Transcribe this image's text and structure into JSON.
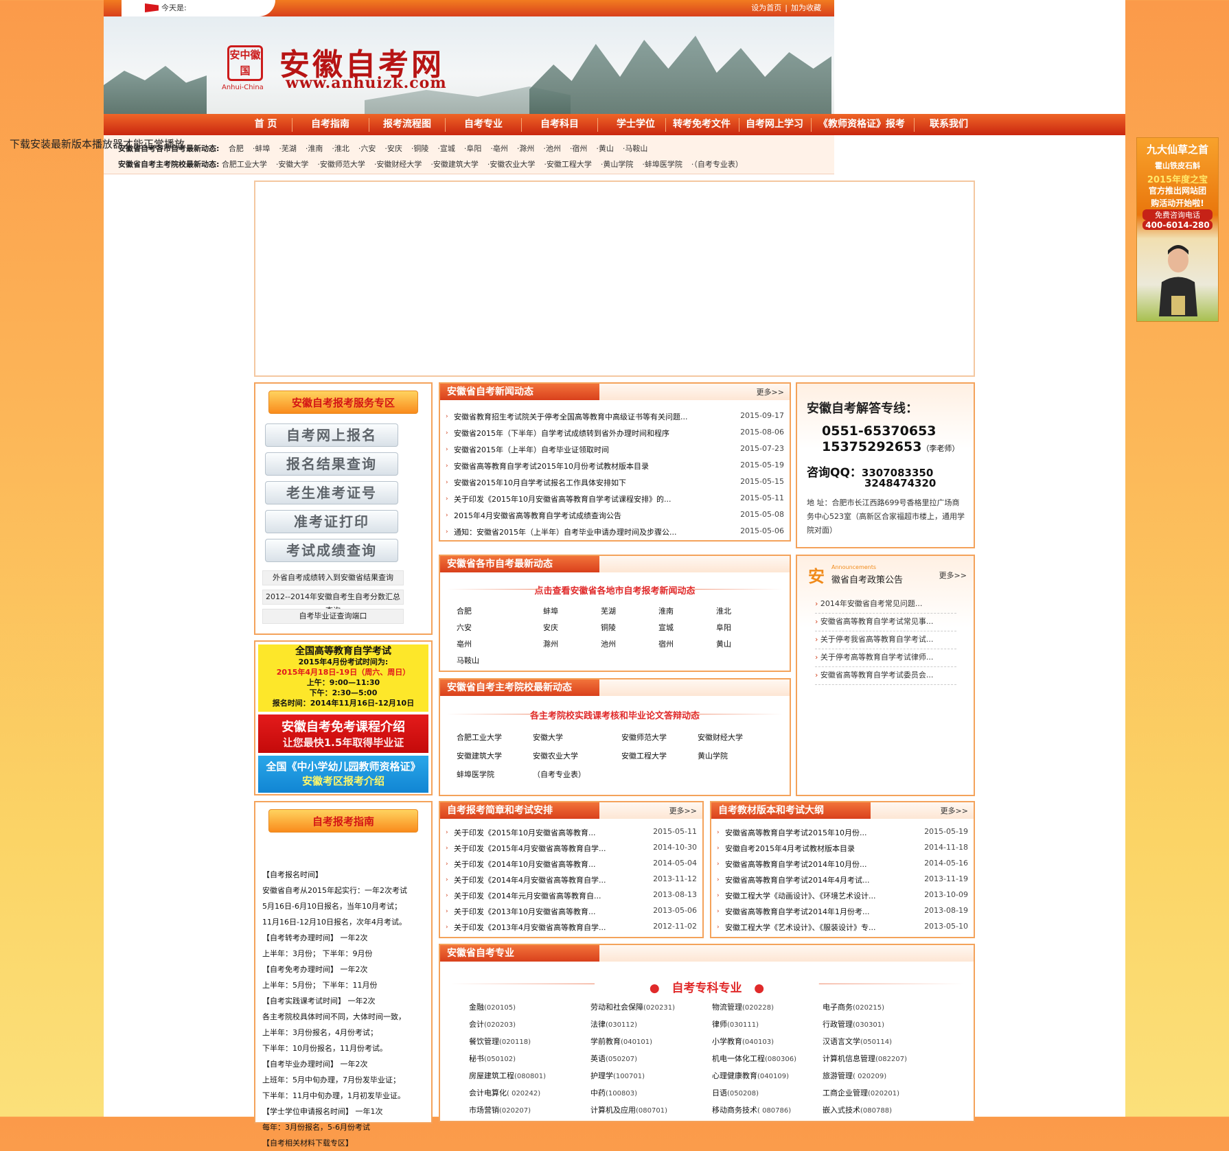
{
  "header": {
    "today_label": "今天是:",
    "set_home": "设为首页",
    "add_fav": "加为收藏",
    "site_title": "安徽自考网",
    "site_url": "www.anhuizk.com",
    "seal_text": "安中徽国",
    "seal_sub": "Anhui-China"
  },
  "nav": [
    "首 页",
    "自考指南",
    "报考流程图",
    "自考专业",
    "自考科目",
    "学士学位",
    "转考免考文件",
    "自考网上学习",
    "《教师资格证》报考",
    "联系我们"
  ],
  "flash_notice": "下载安装最新版本播放器才能正常播放",
  "dynamics": {
    "city_label": "安徽省自考各市自考最新动态:",
    "cities": [
      "合肥",
      "·蚌埠",
      "·芜湖",
      "·淮南",
      "·淮北",
      "·六安",
      "·安庆",
      "·铜陵",
      "·宣城",
      "·阜阳",
      "·亳州",
      "·滁州",
      "·池州",
      "·宿州",
      "·黄山",
      "·马鞍山"
    ],
    "school_label": "安徽省自考主考院校最新动态:",
    "schools": [
      "合肥工业大学",
      "·安徽大学",
      "·安徽师范大学",
      "·安徽财经大学",
      "·安徽建筑大学",
      "·安徽农业大学",
      "·安徽工程大学",
      "·黄山学院",
      "·蚌埠医学院",
      "·（自考专业表）"
    ]
  },
  "service": {
    "title": "安徽自考报考服务专区",
    "buttons": [
      "自考网上报名",
      "报名结果查询",
      "老生准考证号",
      "准考证打印",
      "考试成绩查询"
    ],
    "links": [
      "外省自考成绩转入到安徽省结果查询",
      "2012--2014年安徽自考生自考分数汇总查询",
      "自考毕业证查询端口"
    ]
  },
  "promo": {
    "p1": [
      "全国高等教育自学考试",
      "2015年4月份考试时间为:",
      "2015年4月18日-19日（周六、周日）",
      "上午：9:00—11:30",
      "下午：2:30—5:00",
      "报名时间：2014年11月16日-12月10日"
    ],
    "p2": [
      "安徽自考免考课程介绍",
      "让您最快1.5年取得毕业证"
    ],
    "p3": [
      "全国《中小学幼儿园教师资格证》",
      "安徽考区报考介绍"
    ]
  },
  "guide": {
    "title": "自考报考指南",
    "lines": [
      "【自考报名时间】",
      "安徽省自考从2015年起实行：一年2次考试",
      "5月16日-6月10日报名，当年10月考试；",
      "11月16日-12月10日报名，次年4月考试。",
      "【自考转考办理时间】    一年2次",
      "上半年：3月份；    下半年：9月份",
      "【自考免考办理时间】    一年2次",
      "上半年：5月份；    下半年：11月份",
      "【自考实践课考试时间】     一年2次",
      "各主考院校具体时间不同，大体时间一致，",
      "上半年：3月份报名，4月份考试；",
      "下半年：10月份报名，11月份考试。",
      "【自考毕业办理时间】    一年2次",
      "上班年：5月中旬办理，7月份发毕业证；",
      "下半年：11月中旬办理，1月初发毕业证。",
      "【学士学位申请报名时间】     一年1次",
      "每年：3月份报名，5-6月份考试",
      "【自考相关材料下载专区】"
    ]
  },
  "news": {
    "title": "安徽省自考新闻动态",
    "more": "更多>>",
    "items": [
      {
        "t": "安徽省教育招生考试院关于停考全国高等教育中高级证书等有关问题...",
        "d": "2015-09-17"
      },
      {
        "t": "安徽省2015年（下半年）自学考试成绩转到省外办理时间和程序",
        "d": "2015-08-06"
      },
      {
        "t": "安徽省2015年（上半年）自考毕业证领取时间",
        "d": "2015-07-23"
      },
      {
        "t": "安徽省高等教育自学考试2015年10月份考试教材版本目录",
        "d": "2015-05-19"
      },
      {
        "t": "安徽省2015年10月自学考试报名工作具体安排如下",
        "d": "2015-05-15"
      },
      {
        "t": "关于印发《2015年10月安徽省高等教育自学考试课程安排》的...",
        "d": "2015-05-11"
      },
      {
        "t": "2015年4月安徽省高等教育自学考试成绩查询公告",
        "d": "2015-05-08"
      },
      {
        "t": "通知：安徽省2015年（上半年）自考毕业申请办理时间及步骤公...",
        "d": "2015-05-06"
      }
    ]
  },
  "hotline": {
    "title": "安徽自考解答专线：",
    "phone1": "0551-65370653",
    "phone2": "15375292653",
    "teacher": "（李老师）",
    "qq_label": "咨询QQ：",
    "qq1": "3307083350",
    "qq2": "3248474320",
    "address": "地 址：合肥市长江西路699号香格里拉广场商务中心523室（高新区合家福超市楼上，通用学院对面）"
  },
  "cities_box": {
    "title": "安徽省各市自考最新动态",
    "subtitle": "点击查看安徽省各地市自考报考新闻动态",
    "rows": [
      [
        "合肥",
        "蚌埠",
        "芜湖",
        "淮南",
        "淮北"
      ],
      [
        "六安",
        "安庆",
        "铜陵",
        "宣城",
        "阜阳"
      ],
      [
        "亳州",
        "滁州",
        "池州",
        "宿州",
        "黄山"
      ],
      [
        "马鞍山"
      ]
    ]
  },
  "policy": {
    "icon": "安",
    "eng": "Announcements",
    "title": "徽省自考政策公告",
    "more": "更多>>",
    "items": [
      "2014年安徽省自考常见问题...",
      "安徽省高等教育自学考试常见事...",
      "关于停考我省高等教育自学考试...",
      "关于停考高等教育自学考试律师...",
      "安徽省高等教育自学考试委员会..."
    ]
  },
  "schools_box": {
    "title": "安徽省自考主考院校最新动态",
    "subtitle": "各主考院校实践课考核和毕业论文答辩动态",
    "rows": [
      [
        "合肥工业大学",
        "安徽大学",
        "安徽师范大学",
        "安徽财经大学"
      ],
      [
        "安徽建筑大学",
        "安徽农业大学",
        "安徽工程大学",
        "黄山学院"
      ],
      [
        "蚌埠医学院",
        "（自考专业表）"
      ]
    ]
  },
  "exams": {
    "title": "自考报考简章和考试安排",
    "more": "更多>>",
    "items": [
      {
        "t": "关于印发《2015年10月安徽省高等教育...",
        "d": "2015-05-11"
      },
      {
        "t": "关于印发《2015年4月安徽省高等教育自学...",
        "d": "2014-10-30"
      },
      {
        "t": "关于印发《2014年10月安徽省高等教育...",
        "d": "2014-05-04"
      },
      {
        "t": "关于印发《2014年4月安徽省高等教育自学...",
        "d": "2013-11-12"
      },
      {
        "t": "关于印发《2014年元月安徽省高等教育自...",
        "d": "2013-08-13"
      },
      {
        "t": "关于印发《2013年10月安徽省高等教育...",
        "d": "2013-05-06"
      },
      {
        "t": "关于印发《2013年4月安徽省高等教育自学...",
        "d": "2012-11-02"
      }
    ]
  },
  "textbooks": {
    "title": "自考教材版本和考试大纲",
    "more": "更多>>",
    "items": [
      {
        "t": "安徽省高等教育自学考试2015年10月份...",
        "d": "2015-05-19"
      },
      {
        "t": "安徽自考2015年4月考试教材版本目录",
        "d": "2014-11-18"
      },
      {
        "t": "安徽省高等教育自学考试2014年10月份...",
        "d": "2014-05-16"
      },
      {
        "t": "安徽省高等教育自学考试2014年4月考试...",
        "d": "2013-11-19"
      },
      {
        "t": "安徽工程大学《动画设计》、《环境艺术设计...",
        "d": "2013-10-09"
      },
      {
        "t": "安徽省高等教育自学考试2014年1月份考...",
        "d": "2013-08-19"
      },
      {
        "t": "安徽工程大学《艺术设计》、《服装设计》专...",
        "d": "2013-05-10"
      }
    ]
  },
  "majors": {
    "title": "安徽省自考专业",
    "subtitle": "自考专科专业",
    "rows": [
      [
        [
          "金融",
          "(020105)"
        ],
        [
          "劳动和社会保障",
          "(020231)"
        ],
        [
          "物流管理",
          "(020228)"
        ],
        [
          "电子商务",
          "(020215)"
        ]
      ],
      [
        [
          "会计",
          "(020203)"
        ],
        [
          "法律",
          "(030112)"
        ],
        [
          "律师",
          "(030111)"
        ],
        [
          "行政管理",
          "(030301)"
        ]
      ],
      [
        [
          "餐饮管理",
          "(020118)"
        ],
        [
          "学前教育",
          "(040101)"
        ],
        [
          "小学教育",
          "(040103)"
        ],
        [
          "汉语言文学",
          "(050114)"
        ]
      ],
      [
        [
          "秘书",
          "(050102)"
        ],
        [
          "英语",
          "(050207)"
        ],
        [
          "机电一体化工程",
          "(080306)"
        ],
        [
          "计算机信息管理",
          "(082207)"
        ]
      ],
      [
        [
          "房屋建筑工程",
          "(080801)"
        ],
        [
          "护理学",
          "(100701)"
        ],
        [
          "心理健康教育",
          "(040109)"
        ],
        [
          "旅游管理",
          "( 020209)"
        ]
      ],
      [
        [
          "会计电算化",
          "( 020242)"
        ],
        [
          "中药",
          "(100803)"
        ],
        [
          "日语",
          "(050208)"
        ],
        [
          "工商企业管理",
          "(020201)"
        ]
      ],
      [
        [
          "市场营销",
          "(020207)"
        ],
        [
          "计算机及应用",
          "(080701)"
        ],
        [
          "移动商务技术",
          "( 080786)"
        ],
        [
          "嵌入式技术",
          "(080788)"
        ]
      ]
    ]
  },
  "ad_right": {
    "l1": "九大仙草之首",
    "l2": "霍山铁皮石斛",
    "l3": "2015年度之宝",
    "l4": "官方推出网站团",
    "l5": "购活动开始啦!",
    "l6": "免费咨询电话",
    "l7": "400-6014-280"
  }
}
